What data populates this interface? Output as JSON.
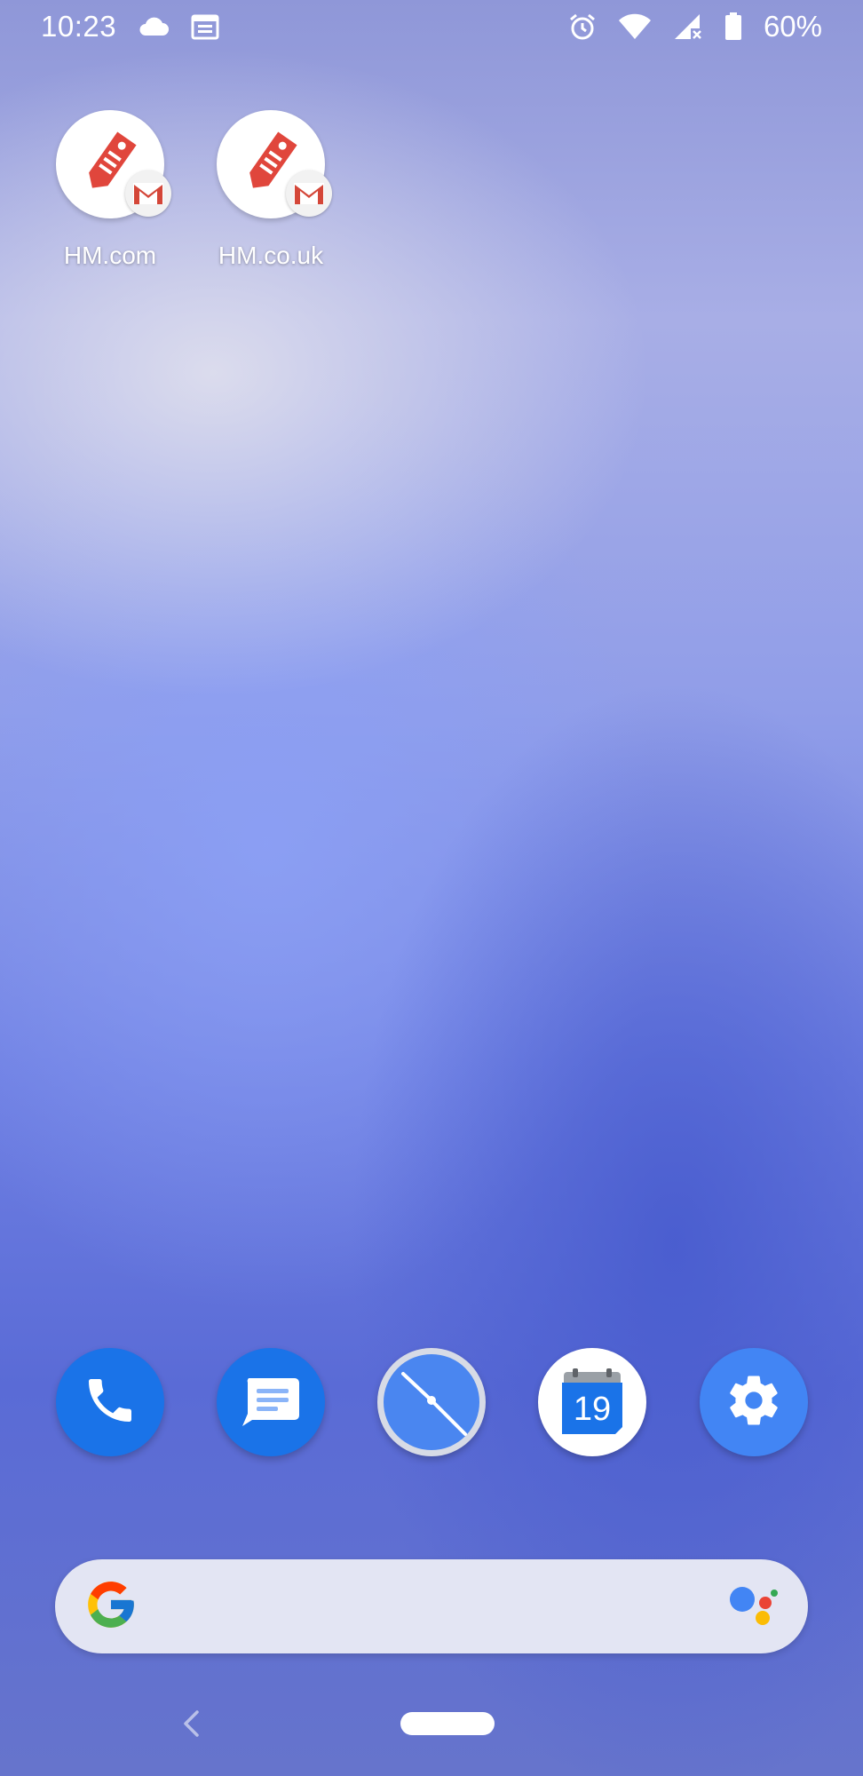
{
  "status_bar": {
    "time": "10:23",
    "battery_percent": "60%",
    "icons": [
      "cloud-icon",
      "calendar-notification-icon",
      "alarm-icon",
      "wifi-icon",
      "signal-no-service-icon",
      "battery-icon"
    ]
  },
  "home_apps": [
    {
      "label": "HM.com",
      "icon": "price-tag-icon",
      "badge": "gmail-badge-icon"
    },
    {
      "label": "HM.co.uk",
      "icon": "price-tag-icon",
      "badge": "gmail-badge-icon"
    }
  ],
  "dock": {
    "items": [
      "phone-icon",
      "messages-icon",
      "clock-icon",
      "calendar-icon",
      "settings-icon"
    ],
    "calendar_day": "19"
  },
  "search_bar": {
    "icons": [
      "google-g-icon",
      "google-assistant-icon"
    ]
  },
  "colors": {
    "dock_blue": "#1a73e8",
    "settings_blue": "#4285f4",
    "tag_red": "#e0463c",
    "search_bar_bg": "#e3e5f3"
  }
}
